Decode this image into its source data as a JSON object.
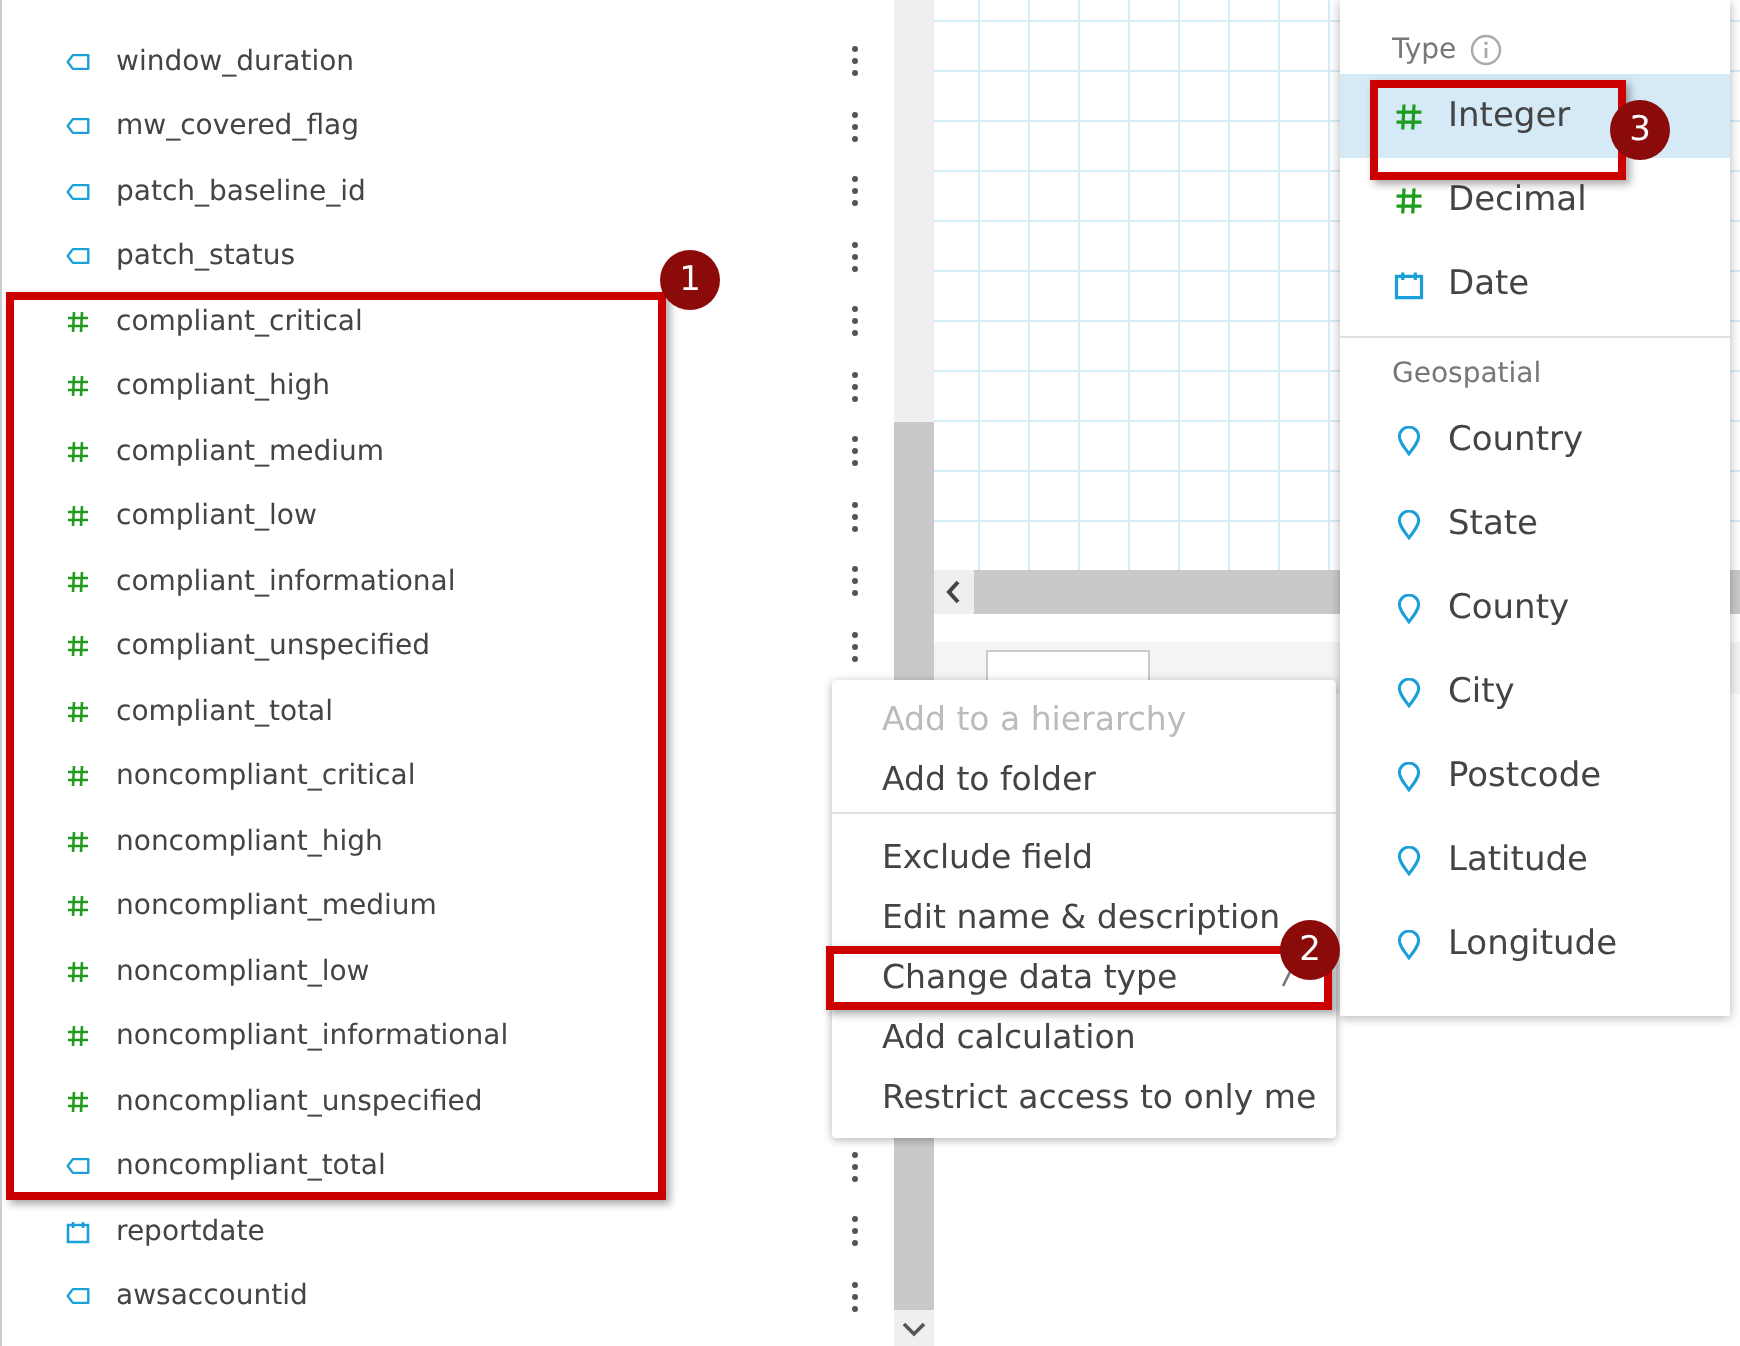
{
  "fields": [
    {
      "name": "window_duration",
      "kind": "text"
    },
    {
      "name": "mw_covered_flag",
      "kind": "text"
    },
    {
      "name": "patch_baseline_id",
      "kind": "text"
    },
    {
      "name": "patch_status",
      "kind": "text"
    },
    {
      "name": "compliant_critical",
      "kind": "number"
    },
    {
      "name": "compliant_high",
      "kind": "number"
    },
    {
      "name": "compliant_medium",
      "kind": "number"
    },
    {
      "name": "compliant_low",
      "kind": "number"
    },
    {
      "name": "compliant_informational",
      "kind": "number"
    },
    {
      "name": "compliant_unspecified",
      "kind": "number"
    },
    {
      "name": "compliant_total",
      "kind": "number"
    },
    {
      "name": "noncompliant_critical",
      "kind": "number"
    },
    {
      "name": "noncompliant_high",
      "kind": "number"
    },
    {
      "name": "noncompliant_medium",
      "kind": "number"
    },
    {
      "name": "noncompliant_low",
      "kind": "number"
    },
    {
      "name": "noncompliant_informational",
      "kind": "number"
    },
    {
      "name": "noncompliant_unspecified",
      "kind": "number"
    },
    {
      "name": "noncompliant_total",
      "kind": "text"
    },
    {
      "name": "reportdate",
      "kind": "date"
    },
    {
      "name": "awsaccountid",
      "kind": "text"
    }
  ],
  "context_menu": {
    "groups": [
      [
        {
          "label": "Add to a hierarchy",
          "disabled": true,
          "has_submenu": false
        },
        {
          "label": "Add to folder",
          "disabled": false,
          "has_submenu": false
        }
      ],
      [
        {
          "label": "Exclude field",
          "disabled": false,
          "has_submenu": false
        },
        {
          "label": "Edit name & description",
          "disabled": false,
          "has_submenu": false
        },
        {
          "label": "Change data type",
          "disabled": false,
          "has_submenu": true
        },
        {
          "label": "Add calculation",
          "disabled": false,
          "has_submenu": false
        },
        {
          "label": "Restrict access to only me",
          "disabled": false,
          "has_submenu": false
        }
      ]
    ]
  },
  "submenu": {
    "sections": [
      {
        "title": "Type",
        "info": true,
        "items": [
          {
            "label": "Integer",
            "kind": "number",
            "selected": true
          },
          {
            "label": "Decimal",
            "kind": "number",
            "selected": false
          },
          {
            "label": "Date",
            "kind": "date",
            "selected": false
          }
        ]
      },
      {
        "title": "Geospatial",
        "info": false,
        "items": [
          {
            "label": "Country",
            "kind": "geo",
            "selected": false
          },
          {
            "label": "State",
            "kind": "geo",
            "selected": false
          },
          {
            "label": "County",
            "kind": "geo",
            "selected": false
          },
          {
            "label": "City",
            "kind": "geo",
            "selected": false
          },
          {
            "label": "Postcode",
            "kind": "geo",
            "selected": false
          },
          {
            "label": "Latitude",
            "kind": "geo",
            "selected": false
          },
          {
            "label": "Longitude",
            "kind": "geo",
            "selected": false
          }
        ]
      }
    ]
  },
  "annotations": [
    {
      "number": "1"
    },
    {
      "number": "2"
    },
    {
      "number": "3"
    }
  ]
}
